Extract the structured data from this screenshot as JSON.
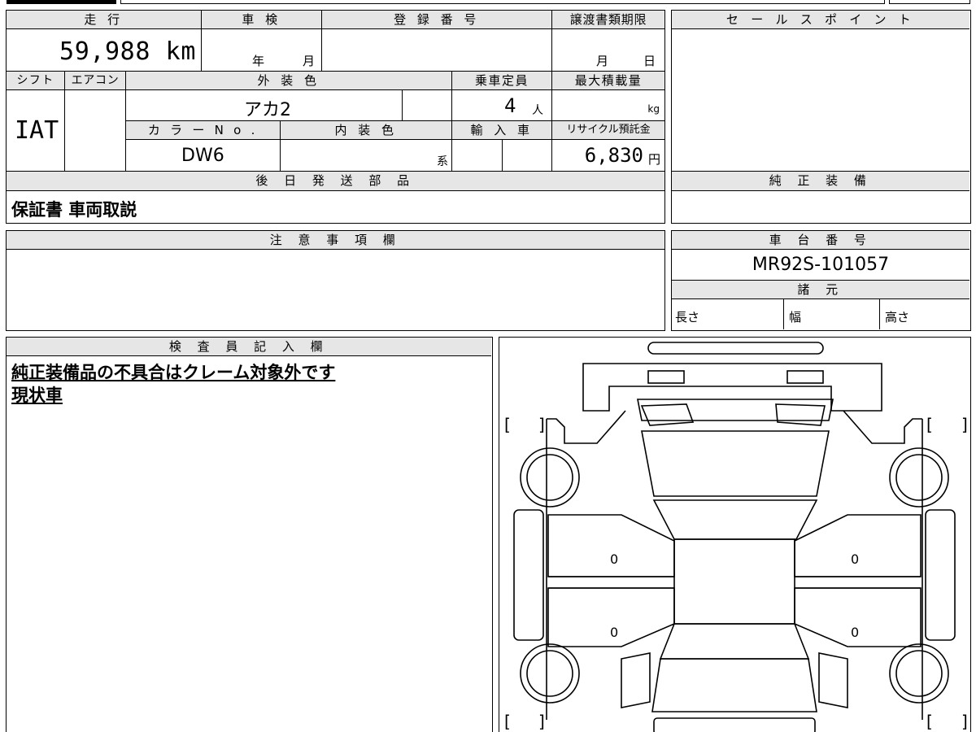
{
  "top_table": {
    "headers": {
      "mileage": "走 行",
      "inspection": "車 検",
      "registration": "登 録 番 号",
      "deadline": "譲渡書類期限",
      "shift": "シフト",
      "aircon": "エアコン",
      "exterior": "外 装 色",
      "capacity": "乗車定員",
      "max_load": "最大積載量",
      "color_no": "カ ラ ー N o .",
      "interior": "内 装 色",
      "import": "輸 入 車",
      "recycle": "リサイクル預託金",
      "later_parts": "後 日 発 送 部 品"
    },
    "mileage_value": "59,988 km",
    "inspection_year": "年",
    "inspection_month": "月",
    "deadline_month": "月",
    "deadline_day": "日",
    "shift_value": "IAT",
    "exterior_value": "アカ2",
    "capacity_value": "4",
    "capacity_unit": "人",
    "max_load_unit": "kg",
    "color_no_value": "DW6",
    "interior_suffix": "系",
    "recycle_value": "6,830",
    "recycle_unit": "円",
    "later_parts_value": "保証書 車両取説"
  },
  "right_panel": {
    "sales_point": "セ ー ル ス ポ イ ン ト",
    "genuine_equipment": "純 正 装 備",
    "chassis_header": "車 台 番 号",
    "chassis_value": "MR92S-101057",
    "specs_header": "諸 元",
    "length": "長さ",
    "width": "幅",
    "height": "高さ"
  },
  "notes": {
    "header": "注 意 事 項 欄"
  },
  "inspector": {
    "header": "検 査 員 記 入 欄",
    "line1": "純正装備品の不具合はクレーム対象外です",
    "line2": "現状車"
  },
  "diagram": {
    "bracket_left": "[",
    "bracket_right": "]",
    "mark_left_1": "0",
    "mark_left_2": "0",
    "mark_right_1": "0",
    "mark_right_2": "0"
  }
}
